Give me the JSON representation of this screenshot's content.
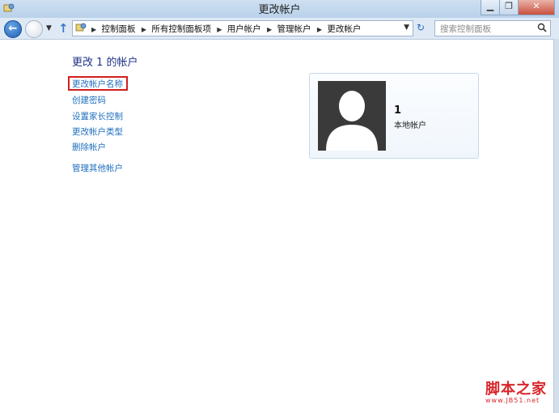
{
  "window": {
    "title": "更改帐户"
  },
  "address": {
    "breadcrumbs": [
      "控制面板",
      "所有控制面板项",
      "用户帐户",
      "管理帐户",
      "更改帐户"
    ],
    "search_placeholder": "搜索控制面板"
  },
  "main": {
    "title": "更改 1 的帐户",
    "tasks": [
      "更改帐户名称",
      "创建密码",
      "设置家长控制",
      "更改帐户类型",
      "删除帐户"
    ],
    "other_task": "管理其他帐户",
    "highlighted_task_index": 0
  },
  "account": {
    "name": "1",
    "type": "本地帐户"
  },
  "watermark": {
    "text": "脚本之家",
    "url": "www.JB51.net"
  },
  "colors": {
    "link": "#1f6fbe",
    "title": "#1e3287",
    "highlight_border": "#d21e1e"
  }
}
